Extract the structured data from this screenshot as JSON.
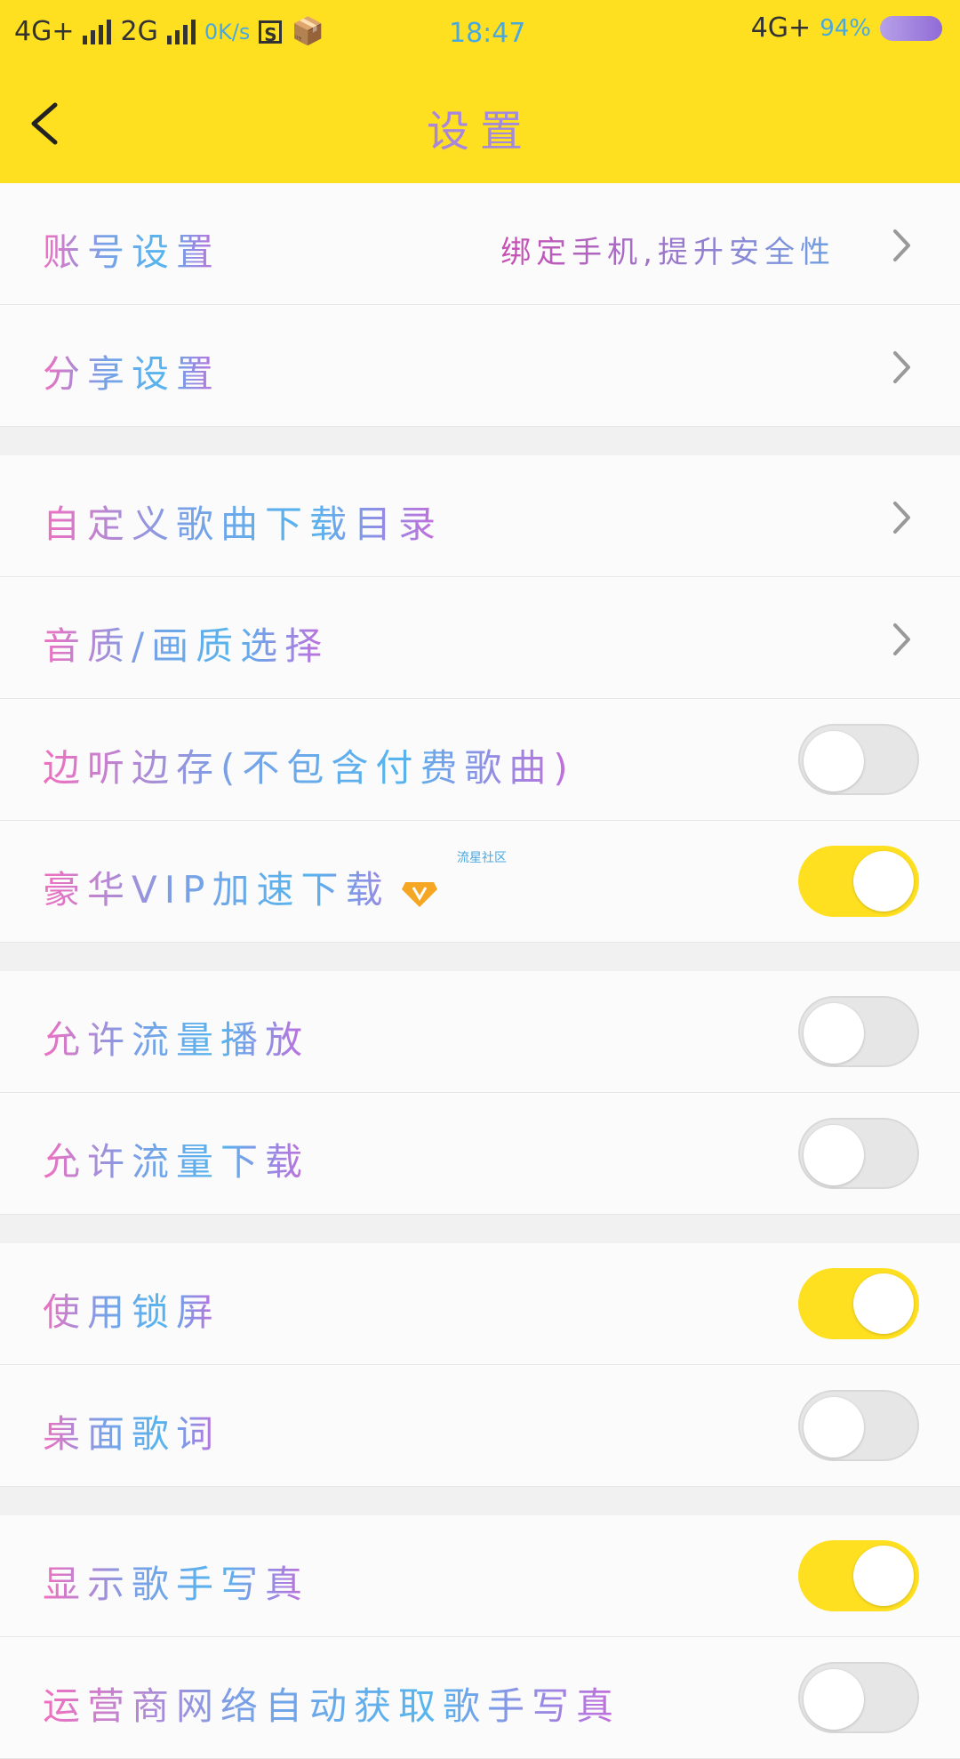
{
  "status_bar": {
    "network1": "4G+",
    "network2": "2G",
    "speed": "0K/s",
    "time": "18:47",
    "network_right": "4G+",
    "battery": "94%"
  },
  "header": {
    "title": "设置",
    "bg_color": "#ffe020"
  },
  "sections": [
    {
      "rows": [
        {
          "label": "账号设置",
          "hint": "绑定手机,提升安全性",
          "control": "chevron"
        },
        {
          "label": "分享设置",
          "control": "chevron"
        }
      ]
    },
    {
      "rows": [
        {
          "label": "自定义歌曲下载目录",
          "control": "chevron"
        },
        {
          "label": "音质/画质选择",
          "control": "chevron"
        },
        {
          "label": "边听边存(不包含付费歌曲)",
          "control": "toggle",
          "on": false
        },
        {
          "label": "豪华VIP加速下载",
          "control": "toggle",
          "on": true,
          "badge": "vip-diamond-icon"
        }
      ]
    },
    {
      "rows": [
        {
          "label": "允许流量播放",
          "control": "toggle",
          "on": false
        },
        {
          "label": "允许流量下载",
          "control": "toggle",
          "on": false
        }
      ]
    },
    {
      "rows": [
        {
          "label": "使用锁屏",
          "control": "toggle",
          "on": true
        },
        {
          "label": "桌面歌词",
          "control": "toggle",
          "on": false
        }
      ]
    },
    {
      "rows": [
        {
          "label": "显示歌手写真",
          "control": "toggle",
          "on": true
        },
        {
          "label": "运营商网络自动获取歌手写真",
          "control": "toggle",
          "on": false
        }
      ]
    }
  ],
  "watermark": "流星社区",
  "colors": {
    "accent": "#ffe020",
    "toggle_off": "#e6e6e6"
  }
}
